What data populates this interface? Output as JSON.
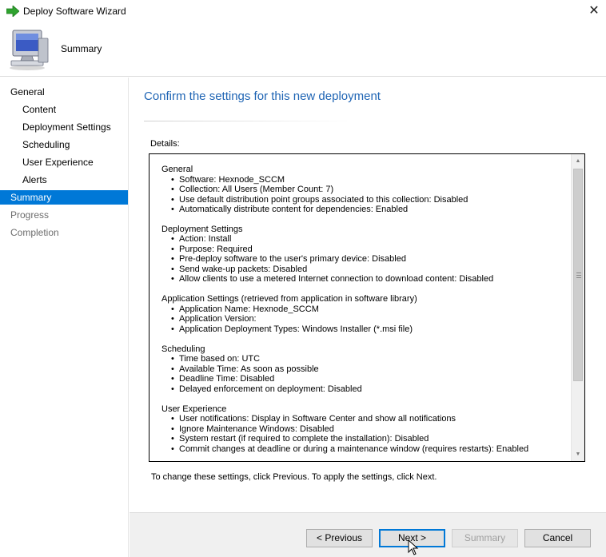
{
  "window": {
    "title": "Deploy Software Wizard",
    "close_glyph": "✕"
  },
  "header": {
    "step_title": "Summary",
    "icon": "computer-icon"
  },
  "sidebar": {
    "items": [
      {
        "label": "General",
        "level": 0,
        "state": "normal"
      },
      {
        "label": "Content",
        "level": 1,
        "state": "normal"
      },
      {
        "label": "Deployment Settings",
        "level": 1,
        "state": "normal"
      },
      {
        "label": "Scheduling",
        "level": 1,
        "state": "normal"
      },
      {
        "label": "User Experience",
        "level": 1,
        "state": "normal"
      },
      {
        "label": "Alerts",
        "level": 1,
        "state": "normal"
      },
      {
        "label": "Summary",
        "level": 0,
        "state": "active"
      },
      {
        "label": "Progress",
        "level": 0,
        "state": "disabled"
      },
      {
        "label": "Completion",
        "level": 0,
        "state": "disabled"
      }
    ]
  },
  "main": {
    "heading": "Confirm the settings for this new deployment",
    "details_label": "Details:",
    "hint": "To change these settings, click Previous. To apply the settings, click Next."
  },
  "details": {
    "sections": [
      {
        "title": "General",
        "items": [
          "Software: Hexnode_SCCM",
          "Collection: All Users (Member Count: 7)",
          "Use default distribution point groups associated to this collection: Disabled",
          "Automatically distribute content for dependencies: Enabled"
        ]
      },
      {
        "title": "Deployment Settings",
        "items": [
          "Action: Install",
          "Purpose: Required",
          "Pre-deploy software to the user's primary device: Disabled",
          "Send wake-up packets: Disabled",
          "Allow clients to use a metered Internet connection to download content: Disabled"
        ]
      },
      {
        "title": "Application Settings (retrieved from application in software library)",
        "items": [
          "Application Name: Hexnode_SCCM",
          "Application Version:",
          "Application Deployment Types: Windows Installer (*.msi file)"
        ]
      },
      {
        "title": "Scheduling",
        "items": [
          "Time based on: UTC",
          "Available Time: As soon as possible",
          "Deadline Time: Disabled",
          "Delayed enforcement on deployment: Disabled"
        ]
      },
      {
        "title": "User Experience",
        "items": [
          "User notifications: Display in Software Center and show all notifications",
          "Ignore Maintenance Windows: Disabled",
          "System restart  (if required to complete the installation): Disabled",
          "Commit changes at deadline or during a maintenance window (requires restarts): Enabled"
        ]
      }
    ]
  },
  "buttons": {
    "previous": "< Previous",
    "next": "Next >",
    "summary": "Summary",
    "cancel": "Cancel"
  },
  "colors": {
    "accent": "#0078d7",
    "heading": "#1e64b4",
    "arrow_icon": "#2fa32f"
  }
}
